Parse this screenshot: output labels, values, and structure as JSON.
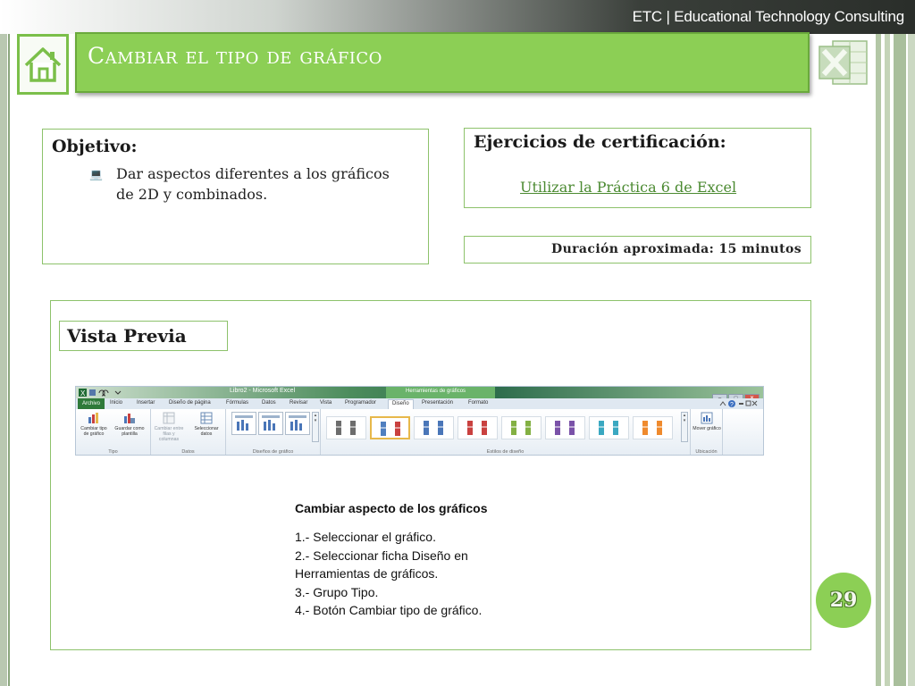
{
  "header": {
    "brand": "ETC | Educational Technology Consulting"
  },
  "slide": {
    "title": "Cambiar el tipo de gráfico",
    "page_number": "29"
  },
  "objetivo": {
    "heading": "Objetivo:",
    "bullet": "Dar aspectos diferentes a los gráficos de 2D y combinados."
  },
  "certificacion": {
    "heading": "Ejercicios de  certificación:",
    "link": "Utilizar la Práctica 6 de Excel"
  },
  "duracion": {
    "text": "Duración aproximada:   15 minutos"
  },
  "vista_previa": {
    "label": "Vista Previa"
  },
  "ribbon": {
    "window_title": "Libro2 - Microsoft Excel",
    "context_tab": "Herramientas de gráficos",
    "tabs": [
      "Archivo",
      "Inicio",
      "Insertar",
      "Diseño de página",
      "Fórmulas",
      "Datos",
      "Revisar",
      "Vista",
      "Programador",
      "Diseño",
      "Presentación",
      "Formato"
    ],
    "groups": {
      "tipo": {
        "label": "Tipo",
        "btn1": "Cambiar tipo de gráfico",
        "btn2": "Guardar como plantilla"
      },
      "datos": {
        "label": "Datos",
        "btn1": "Cambiar entre filas y columnas",
        "btn2": "Seleccionar datos"
      },
      "disenos": {
        "label": "Diseños de gráfico"
      },
      "estilos": {
        "label": "Estilos de diseño"
      },
      "ubicacion": {
        "label": "Ubicación",
        "btn1": "Mover gráfico"
      }
    },
    "colors": {
      "style_colors": [
        "#6d6d6d",
        "#4f7fbf",
        "#4a76b8",
        "#c9413f",
        "#83b043",
        "#7a52a8",
        "#3aa8c1",
        "#ef8a2d"
      ],
      "title_bar": "#2a6a4a",
      "file_tab": "#2f7a3a"
    }
  },
  "instrucciones": {
    "heading": "Cambiar aspecto de los gráficos",
    "steps": [
      "1.- Seleccionar el gráfico.",
      "2.- Seleccionar ficha Diseño en",
      "Herramientas de gráficos.",
      "3.- Grupo Tipo.",
      "4.- Botón Cambiar tipo de gráfico."
    ]
  },
  "theme": {
    "accent": "#8ccf55",
    "border": "#8dc26b",
    "link": "#4b8a31"
  },
  "icons": [
    "home-icon",
    "excel-logo-icon",
    "laptop-bullet-icon"
  ]
}
